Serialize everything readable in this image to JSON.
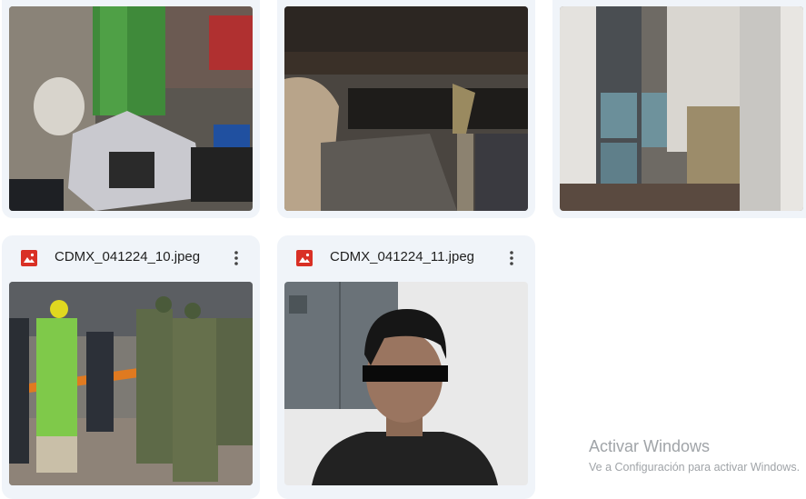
{
  "files": [
    {
      "name": "",
      "image": "photo-items-on-table"
    },
    {
      "name": "",
      "image": "photo-pipe-in-excavation"
    },
    {
      "name": "",
      "image": "photo-fuel-containers-room"
    },
    {
      "name": "CDMX_041224_10.jpeg",
      "image": "photo-soldiers-and-workers",
      "type_icon": "image-file-icon"
    },
    {
      "name": "CDMX_041224_11.jpeg",
      "image": "photo-detained-person",
      "type_icon": "image-file-icon"
    }
  ],
  "watermark": {
    "title": "Activar Windows",
    "subtitle": "Ve a Configuración para activar Windows."
  },
  "colors": {
    "card_bg": "#f0f4f9",
    "image_icon_red": "#d93025",
    "text": "#1f1f1f"
  }
}
